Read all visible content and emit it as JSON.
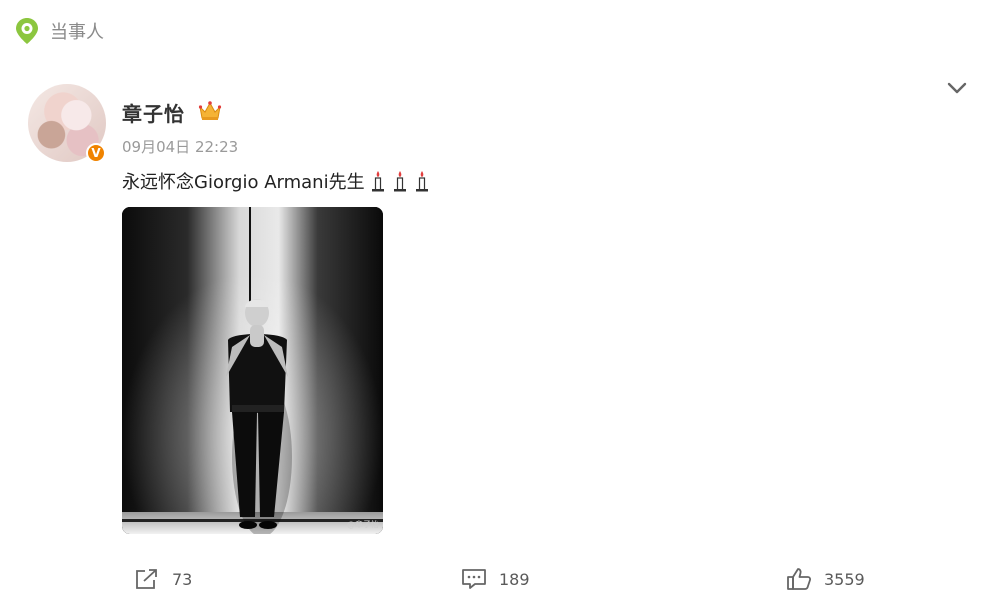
{
  "topbar": {
    "title": "当事人",
    "icon": "location-pin-icon"
  },
  "post": {
    "author": "章子怡",
    "verified_badge": "V",
    "timestamp": "09月04日 22:23",
    "text": "永远怀念Giorgio Armani先生",
    "emoji": [
      "candle-icon",
      "candle-icon",
      "candle-icon"
    ],
    "image_watermark": "@章子怡"
  },
  "actions": {
    "repost_count": "73",
    "comment_count": "189",
    "like_count": "3559"
  },
  "colors": {
    "accent_green": "#8cc63f",
    "verified_orange": "#f08300"
  }
}
